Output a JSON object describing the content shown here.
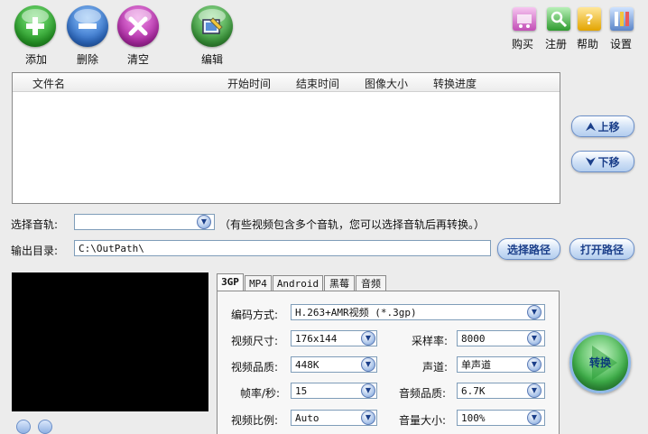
{
  "toolbar": {
    "add_label": "添加",
    "delete_label": "删除",
    "clear_label": "清空",
    "edit_label": "编辑",
    "buy_label": "购买",
    "register_label": "注册",
    "help_label": "帮助",
    "settings_label": "设置"
  },
  "file_list": {
    "columns": [
      "文件名",
      "开始时间",
      "结束时间",
      "图像大小",
      "转换进度"
    ],
    "rows": []
  },
  "move_up_label": "上移",
  "move_down_label": "下移",
  "audio_track": {
    "label": "选择音轨:",
    "value": "",
    "hint": "（有些视频包含多个音轨，您可以选择音轨后再转换。）"
  },
  "output_dir": {
    "label": "输出目录:",
    "value": "C:\\OutPath\\",
    "choose_label": "选择路径",
    "open_label": "打开路径"
  },
  "tabs": [
    "3GP",
    "MP4",
    "Android",
    "黑莓",
    "音频"
  ],
  "settings": {
    "encoding_label": "编码方式:",
    "encoding_value": "H.263+AMR视频 (*.3gp)",
    "video_size_label": "视频尺寸:",
    "video_size_value": "176x144",
    "sample_rate_label": "采样率:",
    "sample_rate_value": "8000",
    "video_quality_label": "视频品质:",
    "video_quality_value": "448K",
    "channel_label": "声道:",
    "channel_value": "单声道",
    "fps_label": "帧率/秒:",
    "fps_value": "15",
    "audio_quality_label": "音频品质:",
    "audio_quality_value": "6.7K",
    "aspect_label": "视频比例:",
    "aspect_value": "Auto",
    "volume_label": "音量大小:",
    "volume_value": "100%"
  },
  "convert_label": "转换",
  "colors": {
    "add": "#3db83d",
    "delete": "#3f7fd6",
    "clear": "#c03bb8",
    "edit": "#3a9a3a",
    "accent": "#6b8fc8"
  }
}
